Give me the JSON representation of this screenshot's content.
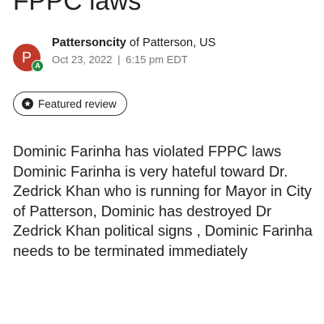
{
  "page": {
    "title": "FPPC laws"
  },
  "review": {
    "author": {
      "initial": "P",
      "badge_letter": "A",
      "avatar_color": "#c0392b",
      "badge_color": "#1e8e3e",
      "name": "Pattersoncity",
      "location": " of Patterson, US"
    },
    "date": "Oct 23, 2022",
    "separator": "|",
    "time": "6:15 pm EDT",
    "featured_label": "Featured review",
    "featured_icon": "star-badge-icon",
    "body": "Dominic Farinha has violated FPPC laws Dominic Farinha is very hateful toward Dr. Zedrick Khan who is running for Mayor in City of Patterson, Dominic has destroyed Dr Zedrick Khan political signs , Dominic Farinha needs to be terminated immediately"
  }
}
